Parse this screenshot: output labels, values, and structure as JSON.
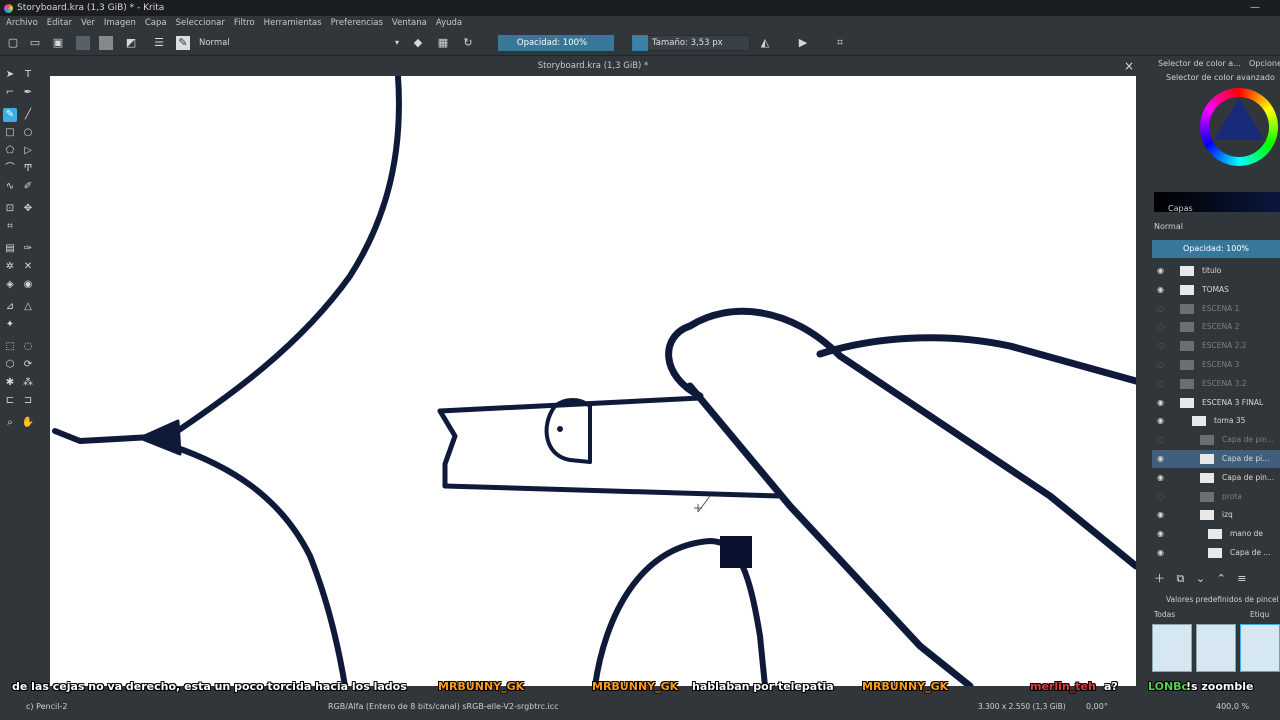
{
  "window": {
    "title": "Storyboard.kra (1,3 GiB) * - Krita",
    "controls": "—"
  },
  "menu": [
    "Archivo",
    "Editar",
    "Ver",
    "Imagen",
    "Capa",
    "Seleccionar",
    "Filtro",
    "Herramientas",
    "Preferencias",
    "Ventana",
    "Ayuda"
  ],
  "toolbar": {
    "blend_mode": "Normal",
    "opacity": "Opacidad: 100%",
    "size": "Tamaño: 3,53 px"
  },
  "document": {
    "tab_title": "Storyboard.kra (1,3 GiB) *",
    "close": "×"
  },
  "dock": {
    "tab_color": "Selector de color a...",
    "tab_options": "Opcione",
    "advanced_color": "Selector de color avanzado",
    "layers_title": "Capas",
    "layers_blend": "Normal",
    "layers_opacity": "Opacidad:  100%",
    "layers": [
      {
        "name": "titulo",
        "dim": false,
        "selected": false
      },
      {
        "name": "TOMAS",
        "dim": false,
        "selected": false
      },
      {
        "name": "ESCENA 1",
        "dim": true,
        "selected": false
      },
      {
        "name": "ESCENA 2",
        "dim": true,
        "selected": false
      },
      {
        "name": "ESCENA 2.2",
        "dim": true,
        "selected": false
      },
      {
        "name": "ESCENA 3",
        "dim": true,
        "selected": false
      },
      {
        "name": "ESCENA 3.2",
        "dim": true,
        "selected": false
      },
      {
        "name": "ESCENA 3 FINAL",
        "dim": false,
        "selected": false
      },
      {
        "name": "toma 35",
        "dim": false,
        "selected": false
      },
      {
        "name": "Capa de pin...",
        "dim": true,
        "selected": false
      },
      {
        "name": "Capa de pi...",
        "dim": false,
        "selected": true
      },
      {
        "name": "Capa de pin...",
        "dim": false,
        "selected": false
      },
      {
        "name": "prota",
        "dim": true,
        "selected": false
      },
      {
        "name": "izq",
        "dim": false,
        "selected": false
      },
      {
        "name": "mano de",
        "dim": false,
        "selected": false
      },
      {
        "name": "Capa de ...",
        "dim": false,
        "selected": false
      }
    ],
    "presets_label": "Valores predefinidos de pincel",
    "presets_filter": "Todas",
    "presets_tag": "Etiqu"
  },
  "chat": [
    {
      "text": "de las cejas no va derecho, esta un poco torcida hacia los lados",
      "user": false
    },
    {
      "text": "MRBUNNY_GK",
      "user": true
    },
    {
      "text": "MRBUNNY_GK",
      "user": true
    },
    {
      "text": "hablaban por telepatia",
      "user": false
    },
    {
      "text": "MRBUNNY_GK",
      "user": true
    },
    {
      "text": "merlin_teh",
      "user": true
    },
    {
      "text": "a?",
      "user": false
    },
    {
      "text": "LONBo",
      "user": true
    },
    {
      "text": "!s zoomble",
      "user": false
    }
  ],
  "status": {
    "brush": "c) Pencil-2",
    "color_space": "RGB/Alfa (Entero de 8 bits/canal)  sRGB-elle-V2-srgbtrc.icc",
    "dimensions": "3.300 x 2.550 (1,3 GiB)",
    "rotation": "0,00°",
    "zoom": "400,0 %"
  },
  "colors": {
    "accent": "#3daee9",
    "ink": "#0f1a3a",
    "background": "#31363b"
  }
}
